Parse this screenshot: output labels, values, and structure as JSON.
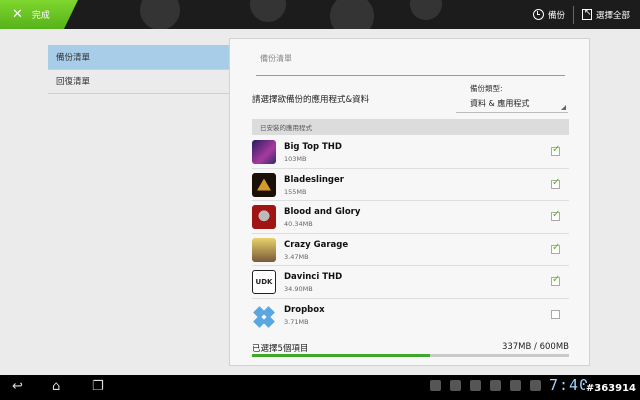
{
  "actionbar": {
    "done_label": "完成",
    "backup_label": "備份",
    "select_all_label": "選擇全部"
  },
  "sidebar": {
    "items": [
      {
        "label": "備份清單",
        "active": true
      },
      {
        "label": "回復清單",
        "active": false
      }
    ]
  },
  "panel": {
    "title": "備份清單",
    "prompt": "請選擇欲備份的應用程式&資料",
    "backup_type_label": "備份類型:",
    "backup_type_value": "資料 & 應用程式",
    "installed_header": "已安裝的應用程式",
    "apps": [
      {
        "name": "Big Top THD",
        "size": "103MB",
        "checked": true,
        "icon": "big-top-thd-icon"
      },
      {
        "name": "Bladeslinger",
        "size": "155MB",
        "checked": true,
        "icon": "bladeslinger-icon"
      },
      {
        "name": "Blood and Glory",
        "size": "40.34MB",
        "checked": true,
        "icon": "blood-and-glory-icon"
      },
      {
        "name": "Crazy Garage",
        "size": "3.47MB",
        "checked": true,
        "icon": "crazy-garage-icon"
      },
      {
        "name": "Davinci THD",
        "size": "34.90MB",
        "checked": true,
        "icon": "davinci-thd-icon"
      },
      {
        "name": "Dropbox",
        "size": "3.71MB",
        "checked": false,
        "icon": "dropbox-icon"
      }
    ],
    "davinci_icon_text": "UDK",
    "selected_summary": "已選擇5個項目",
    "storage": "337MB / 600MB",
    "progress_fraction": 0.56
  },
  "navbar": {
    "clock": "7:40",
    "watermark": "#363914"
  },
  "colors": {
    "accent_green": "#56b21a",
    "selection_blue": "#a8cde9",
    "progress_green": "#3fa82c",
    "clock_blue": "#9fd4ff"
  }
}
